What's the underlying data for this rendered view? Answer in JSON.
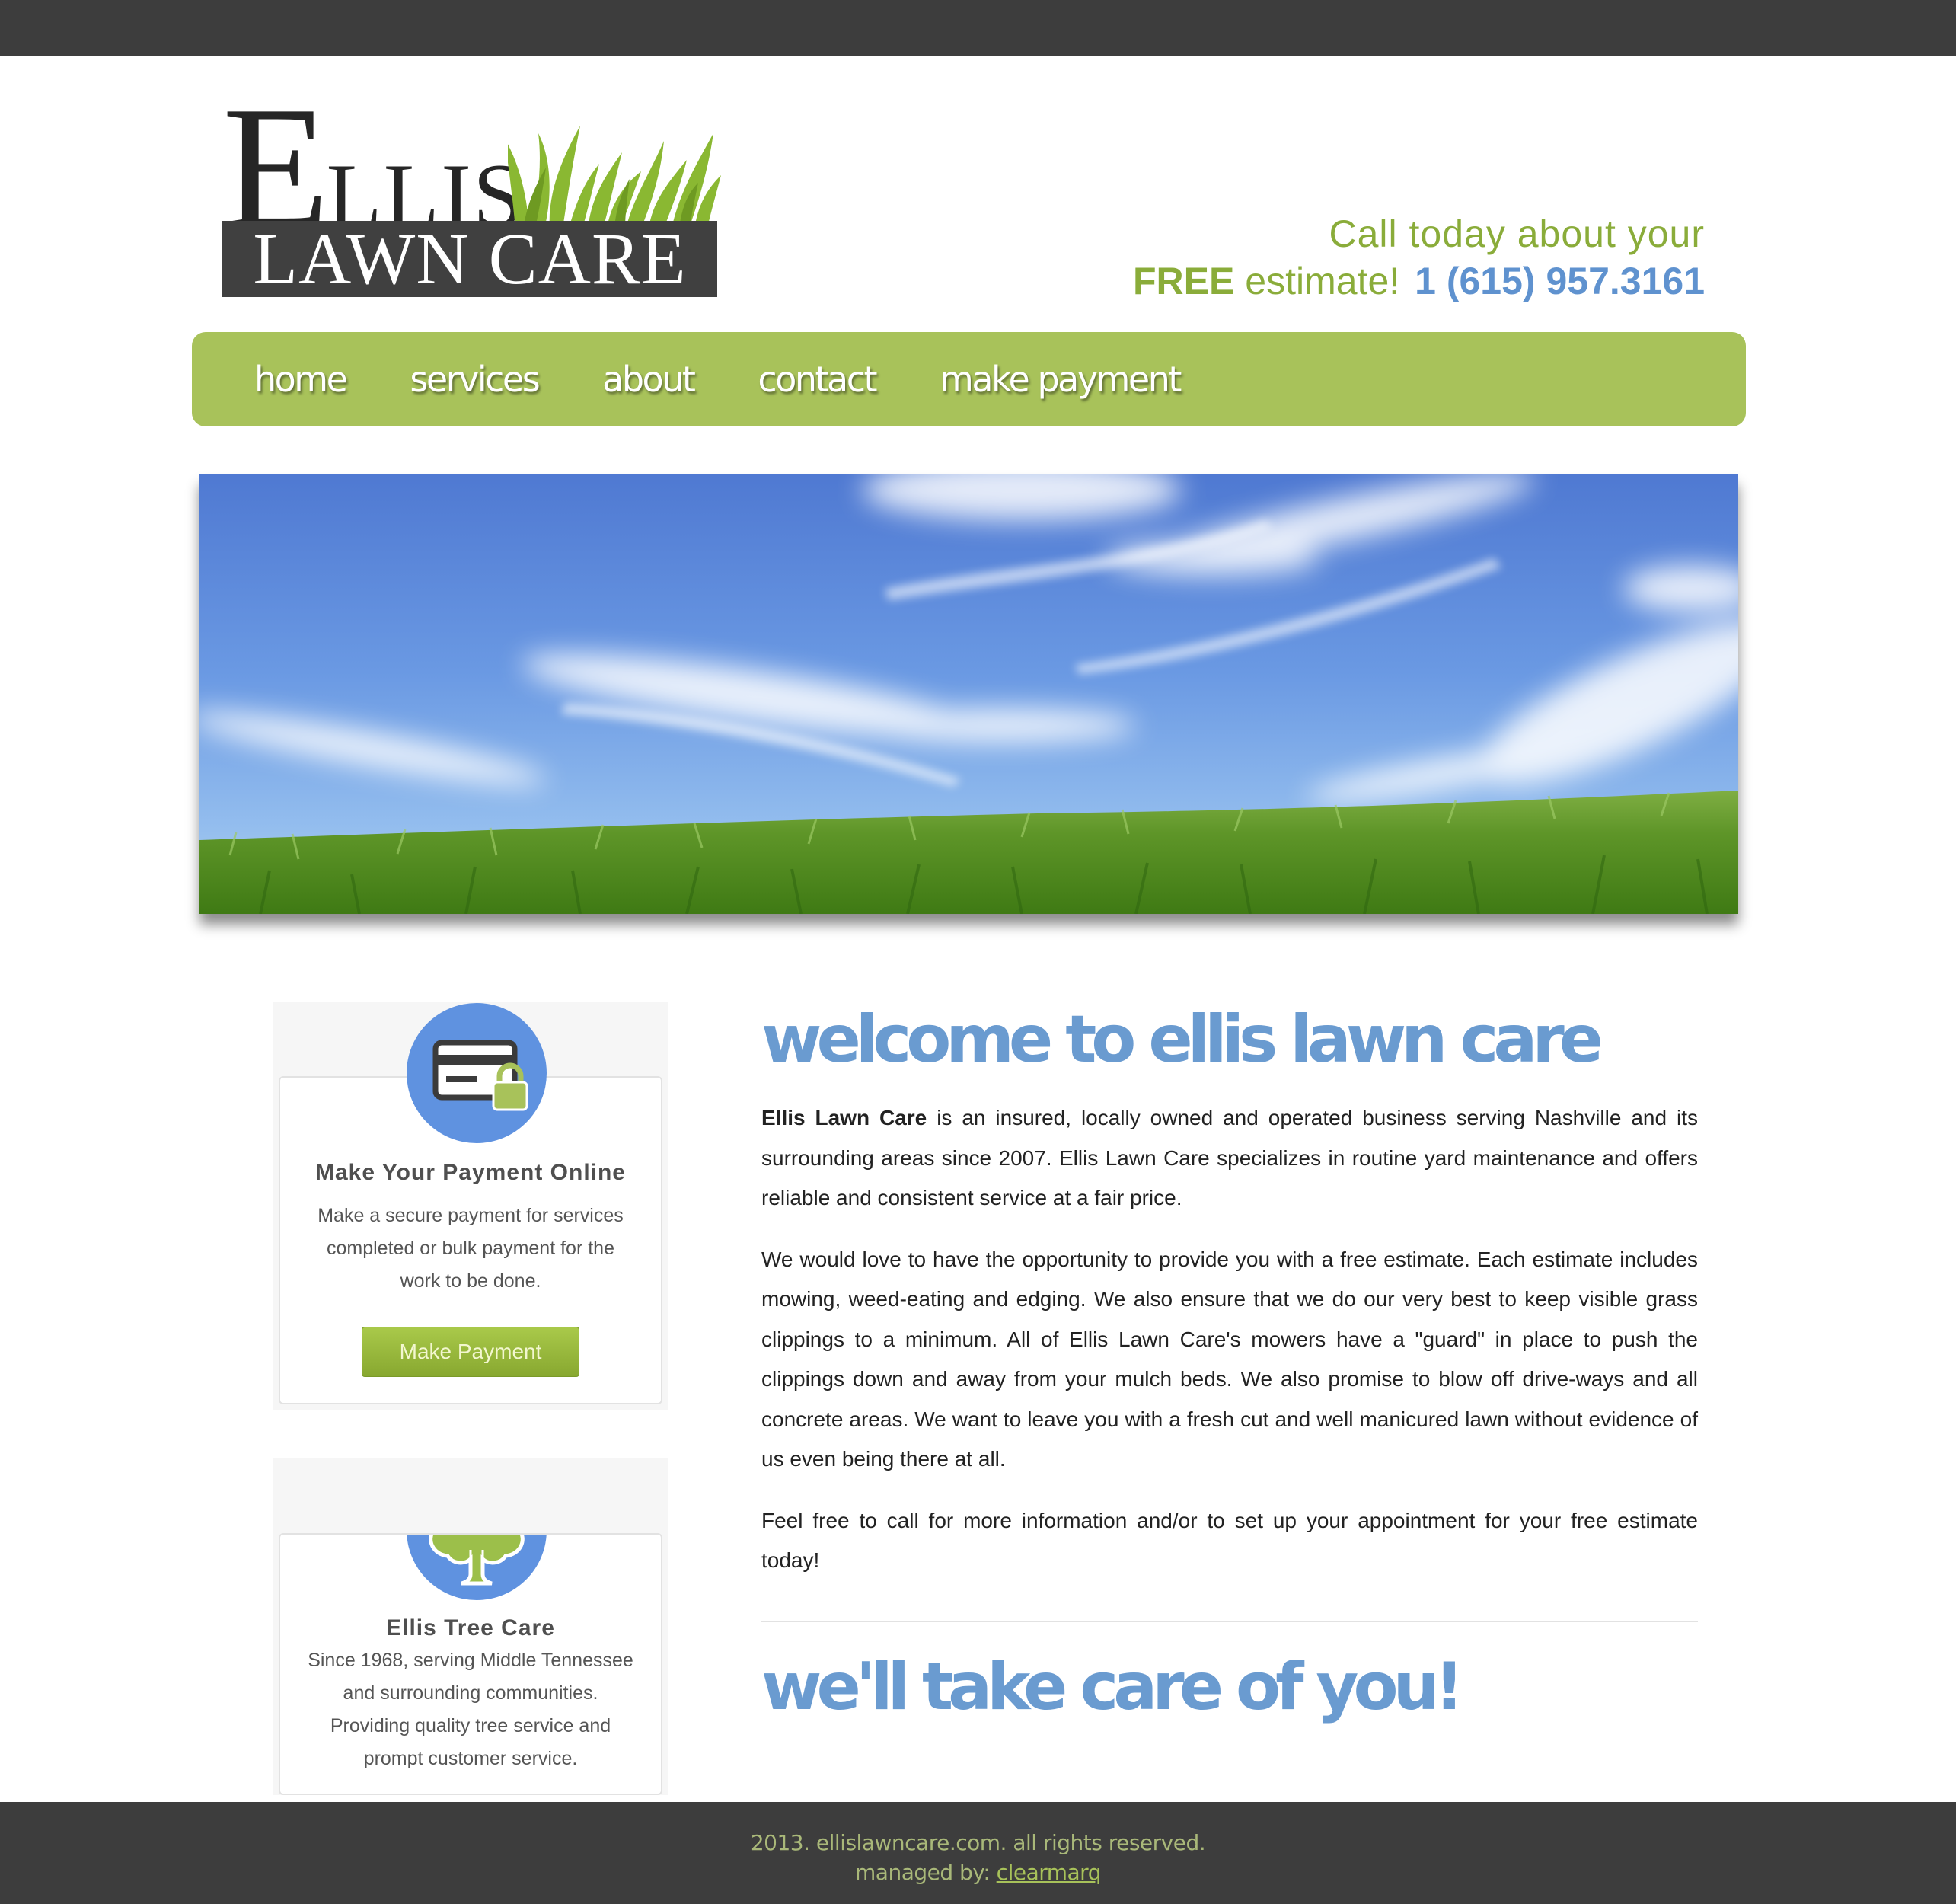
{
  "header": {
    "logo_ellis_first": "E",
    "logo_ellis_rest": "LLIS",
    "logo_lawn_care": "LAWN CARE",
    "cta_line1": "Call today about your",
    "cta_free": "FREE",
    "cta_estimate": "estimate!",
    "cta_phone": "1 (615) 957.3161"
  },
  "nav": {
    "items": [
      "home",
      "services",
      "about",
      "contact",
      "make payment"
    ]
  },
  "sidebar": {
    "payment_card": {
      "title": "Make Your Payment Online",
      "text_lines": [
        "Make a secure payment for services",
        "completed or bulk payment for the",
        "work to be done."
      ],
      "button_label": "Make Payment"
    },
    "tree_card": {
      "title": "Ellis Tree Care",
      "text_lines": [
        "Since 1968, serving Middle Tennessee",
        "and surrounding communities.",
        "Providing quality tree service and",
        "prompt customer service."
      ]
    }
  },
  "main": {
    "welcome_title": "welcome to ellis lawn care",
    "p1_bold": "Ellis Lawn Care",
    "p1_rest": " is an insured, locally owned and operated business serving Nashville and its surrounding areas since 2007. Ellis Lawn Care specializes in routine yard maintenance and offers reliable and consistent service at a fair price.",
    "p2": "We would love to have the opportunity to provide you with a free estimate. Each estimate includes mowing, weed-eating and edging. We also ensure that we do our very best to keep visible grass clippings to a minimum. All of Ellis Lawn Care's mowers have a \"guard\" in place to push the clippings down and away from your mulch beds. We also promise to blow off drive-ways and all concrete areas. We want to leave you with a fresh cut and well manicured lawn without evidence of us even being there at all.",
    "p3": "Feel free to call for more information and/or to set up your appointment for your free estimate today!",
    "care_title": "we'll take care of you!"
  },
  "footer": {
    "copyright": "2013. ellislawncare.com. all rights reserved.",
    "managed_prefix": "managed by: ",
    "managed_link": "clearmarq"
  }
}
